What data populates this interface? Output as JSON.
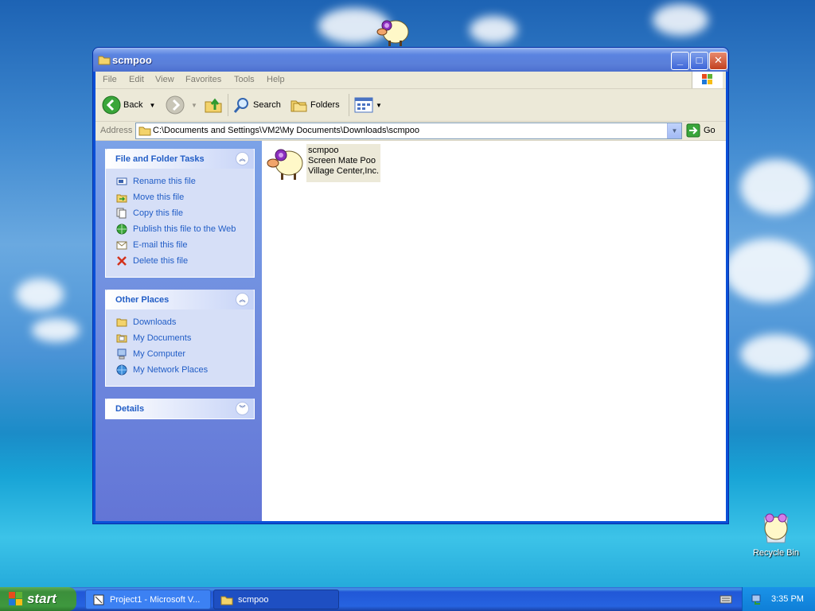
{
  "window": {
    "title": "scmpoo",
    "menu": [
      "File",
      "Edit",
      "View",
      "Favorites",
      "Tools",
      "Help"
    ],
    "toolbar": {
      "back": "Back",
      "search": "Search",
      "folders": "Folders"
    },
    "address": {
      "label": "Address",
      "path": "C:\\Documents and Settings\\VM2\\My Documents\\Downloads\\scmpoo",
      "go": "Go"
    }
  },
  "sidebar": {
    "tasks": {
      "title": "File and Folder Tasks",
      "items": [
        "Rename this file",
        "Move this file",
        "Copy this file",
        "Publish this file to the Web",
        "E-mail this file",
        "Delete this file"
      ]
    },
    "places": {
      "title": "Other Places",
      "items": [
        "Downloads",
        "My Documents",
        "My Computer",
        "My Network Places"
      ]
    },
    "details": {
      "title": "Details"
    }
  },
  "file": {
    "name": "scmpoo",
    "desc": "Screen Mate Poo",
    "company": "Village Center,Inc."
  },
  "taskbar": {
    "start": "start",
    "items": [
      "Project1 - Microsoft V...",
      "scmpoo"
    ],
    "time": "3:35 PM"
  },
  "desktop": {
    "recycle_bin": "Recycle Bin"
  }
}
